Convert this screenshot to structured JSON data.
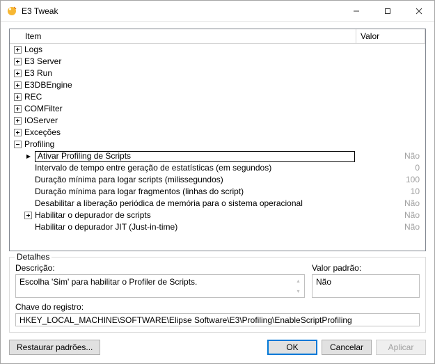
{
  "window": {
    "title": "E3 Tweak"
  },
  "columns": {
    "item": "Item",
    "valor": "Valor"
  },
  "tree": {
    "roots": [
      {
        "label": "Logs"
      },
      {
        "label": "E3 Server"
      },
      {
        "label": "E3 Run"
      },
      {
        "label": "E3DBEngine"
      },
      {
        "label": "REC"
      },
      {
        "label": "COMFilter"
      },
      {
        "label": "IOServer"
      },
      {
        "label": "Exceções"
      }
    ],
    "profiling": {
      "label": "Profiling",
      "children": [
        {
          "label": "Ativar Profiling de Scripts",
          "value": "Não",
          "selected": true
        },
        {
          "label": "Intervalo de tempo entre geração de estatísticas (em segundos)",
          "value": "0"
        },
        {
          "label": "Duração mínima para logar scripts (milissegundos)",
          "value": "100"
        },
        {
          "label": "Duração mínima para logar fragmentos (linhas do script)",
          "value": "10"
        },
        {
          "label": "Desabilitar a liberação periódica de memória para o sistema operacional",
          "value": "Não"
        },
        {
          "label": "Habilitar o depurador de scripts",
          "value": "Não",
          "expandable": true
        },
        {
          "label": "Habilitar o depurador JIT (Just-in-time)",
          "value": "Não"
        }
      ]
    }
  },
  "details": {
    "group": "Detalhes",
    "descricao_label": "Descrição:",
    "descricao_value": "Escolha 'Sim' para habilitar o Profiler de Scripts.",
    "valor_padrao_label": "Valor padrão:",
    "valor_padrao_value": "Não",
    "chave_label": "Chave do registro:",
    "chave_value": "HKEY_LOCAL_MACHINE\\SOFTWARE\\Elipse Software\\E3\\Profiling\\EnableScriptProfiling"
  },
  "buttons": {
    "restore": "Restaurar padrões...",
    "ok": "OK",
    "cancel": "Cancelar",
    "apply": "Aplicar"
  }
}
